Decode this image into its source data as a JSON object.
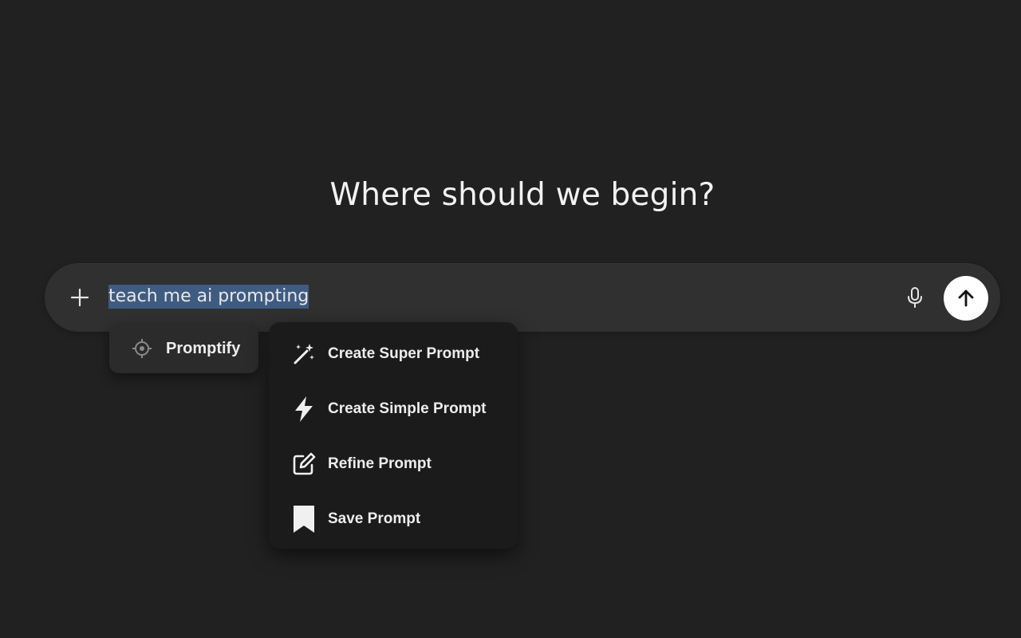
{
  "main": {
    "headline": "Where should we begin?"
  },
  "composer": {
    "input_value": "teach me ai prompting",
    "icons": {
      "add": "plus-icon",
      "voice": "microphone-icon",
      "send": "arrow-up-icon"
    }
  },
  "promptify": {
    "label": "Promptify",
    "icon": "crosshair-icon"
  },
  "menu": {
    "items": [
      {
        "label": "Create Super Prompt",
        "icon": "magic-wand-icon"
      },
      {
        "label": "Create Simple Prompt",
        "icon": "lightning-bolt-icon"
      },
      {
        "label": "Refine Prompt",
        "icon": "edit-icon"
      },
      {
        "label": "Save Prompt",
        "icon": "bookmark-icon"
      }
    ]
  },
  "colors": {
    "background": "#212121",
    "composer": "#303030",
    "selection": "#3e5b82",
    "menu": "#1b1b1b",
    "send_button": "#ffffff"
  }
}
